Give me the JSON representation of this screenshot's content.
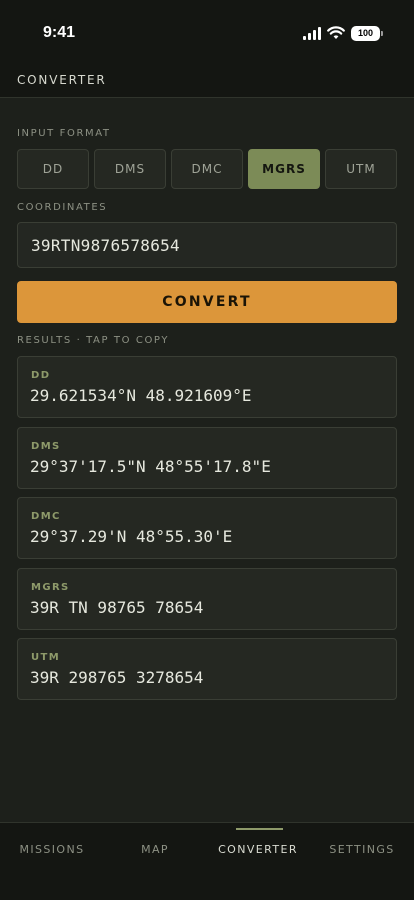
{
  "status_bar": {
    "time": "9:41",
    "battery": "100"
  },
  "header": {
    "title": "CONVERTER"
  },
  "input_format": {
    "label": "INPUT FORMAT",
    "options": [
      "DD",
      "DMS",
      "DMC",
      "MGRS",
      "UTM"
    ],
    "selected": "MGRS"
  },
  "coordinates": {
    "label": "COORDINATES",
    "value": "39RTN9876578654"
  },
  "convert_label": "CONVERT",
  "results": {
    "label": "RESULTS · TAP TO COPY",
    "items": [
      {
        "label": "DD",
        "value": "29.621534°N 48.921609°E"
      },
      {
        "label": "DMS",
        "value": "29°37'17.5\"N 48°55'17.8\"E"
      },
      {
        "label": "DMC",
        "value": "29°37.29'N 48°55.30'E"
      },
      {
        "label": "MGRS",
        "value": "39R TN 98765 78654"
      },
      {
        "label": "UTM",
        "value": "39R 298765 3278654"
      }
    ]
  },
  "tabs": {
    "items": [
      "MISSIONS",
      "MAP",
      "CONVERTER",
      "SETTINGS"
    ],
    "active": "CONVERTER"
  }
}
